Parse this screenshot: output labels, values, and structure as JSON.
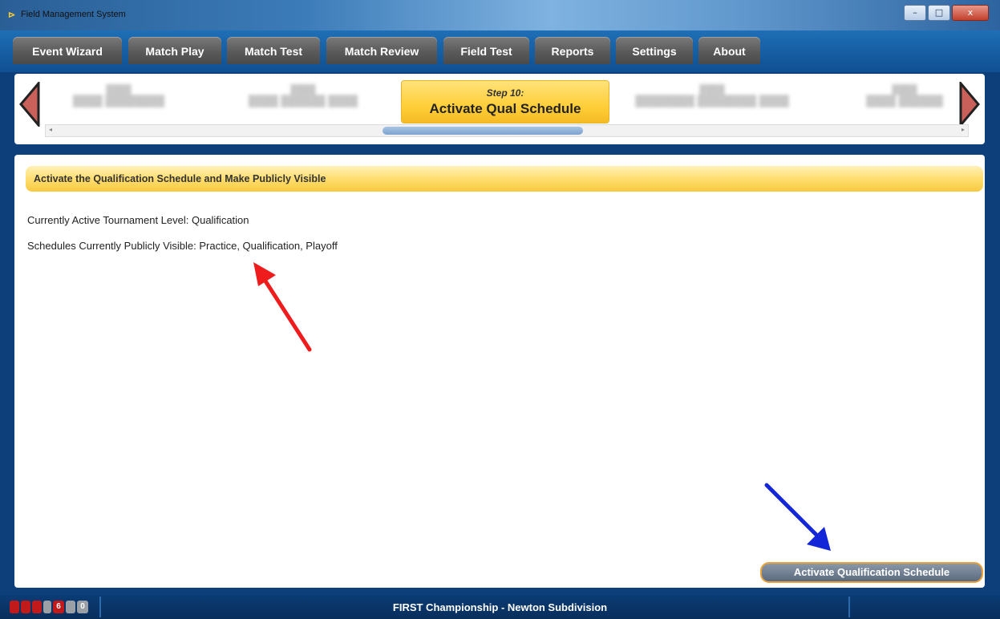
{
  "window": {
    "title": "Field Management System",
    "controls": [
      "–",
      "□",
      "x"
    ]
  },
  "menu": [
    "Event Wizard",
    "Match Play",
    "Match Test",
    "Match Review",
    "Field Test",
    "Reports",
    "Settings",
    "About"
  ],
  "steps": {
    "active_step_number": "Step 10:",
    "active_step_title": "Activate Qual Schedule"
  },
  "content": {
    "header": "Activate the Qualification Schedule and Make Publicly Visible",
    "active_level": "Currently Active Tournament Level: Qualification",
    "visible_schedules": "Schedules Currently Publicly Visible: Practice, Qualification, Playoff",
    "button_label": "Activate Qualification Schedule"
  },
  "status": {
    "event_name": "FIRST Championship - Newton Subdivision",
    "indicator_6": "6",
    "indicator_0": "0"
  },
  "colors": {
    "accent_yellow": "#ffcf3a",
    "bar_blue": "#0f4f92",
    "status_bg": "#082e5c"
  }
}
